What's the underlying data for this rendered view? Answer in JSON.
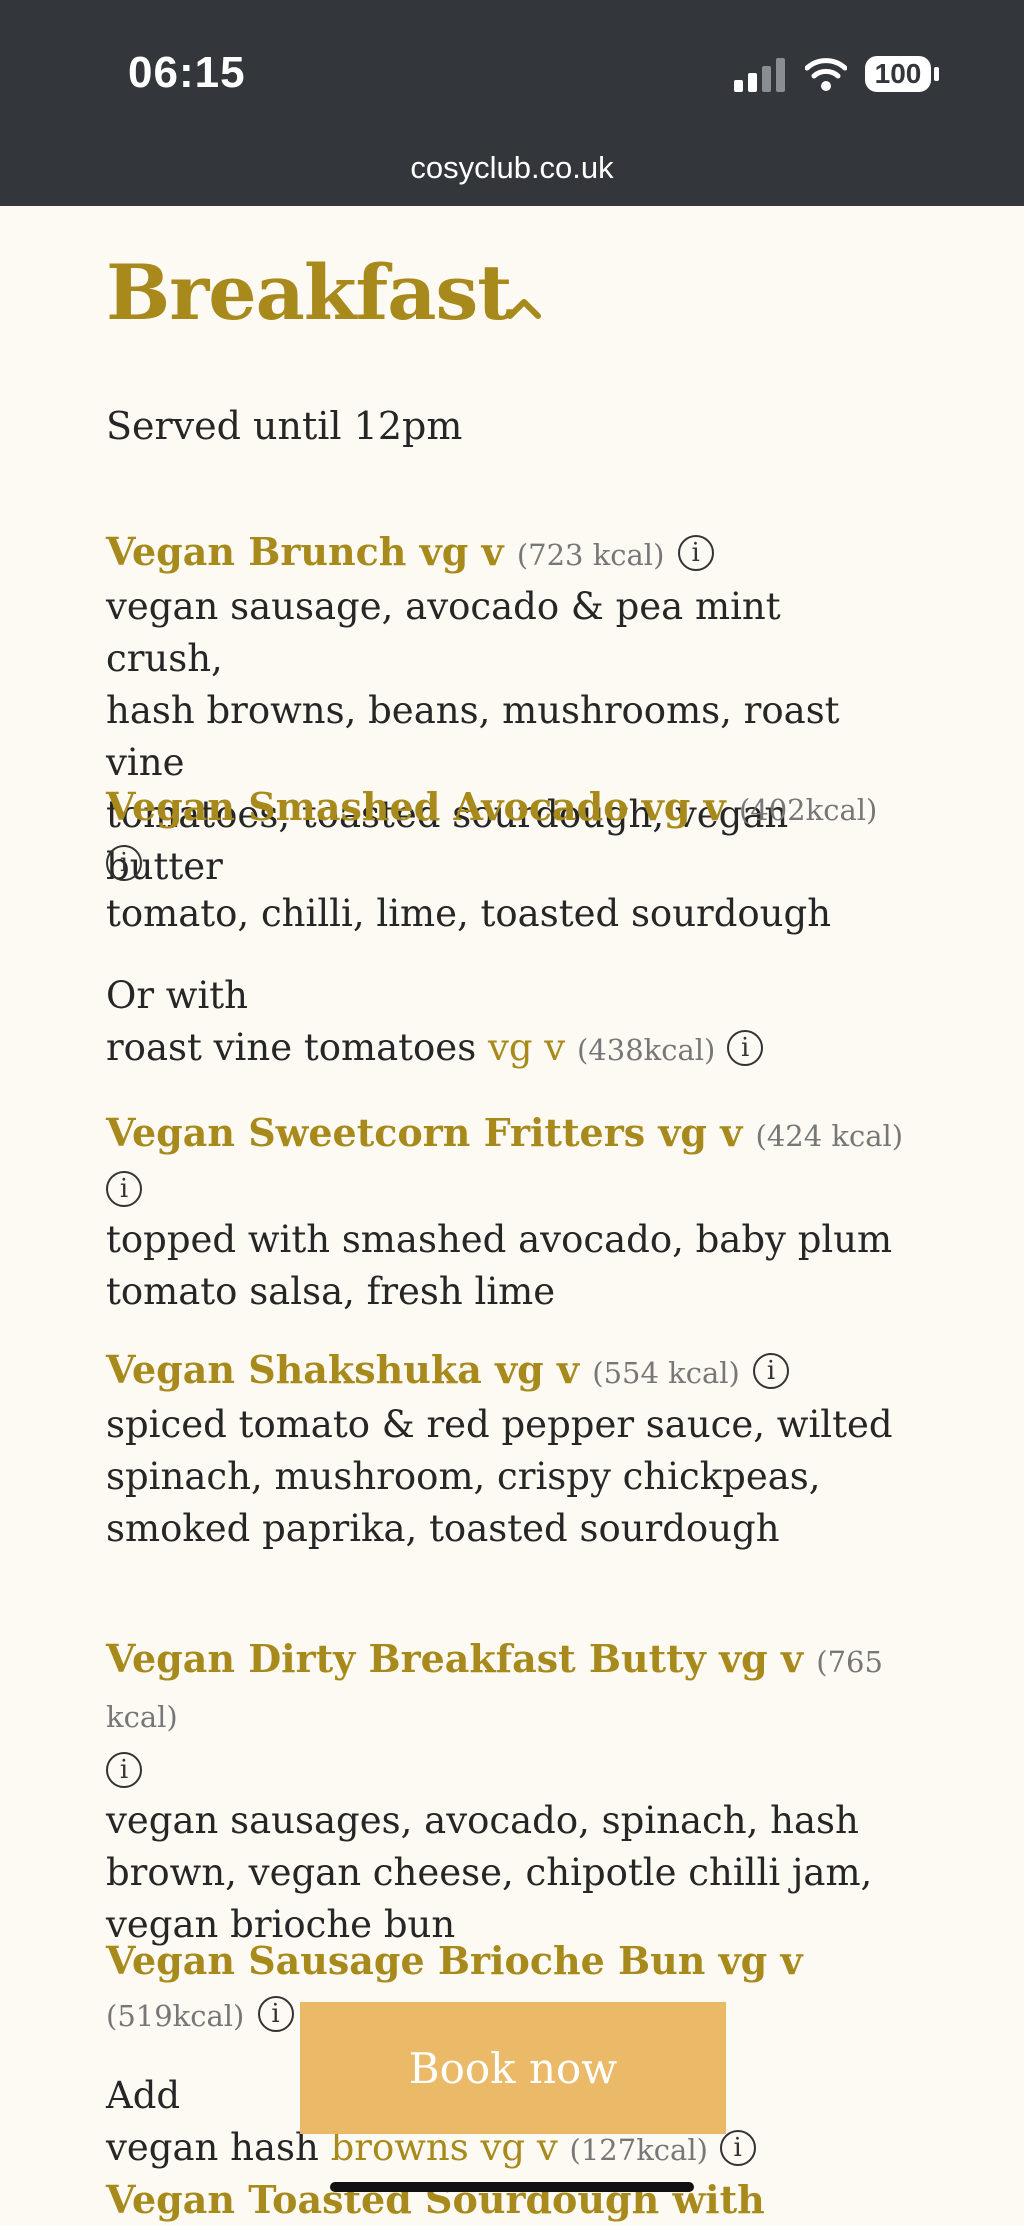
{
  "status": {
    "time": "06:15",
    "battery": "100",
    "url": "cosyclub.co.uk"
  },
  "section": {
    "title": "Breakfast",
    "served": "Served until 12pm"
  },
  "items": [
    {
      "name": "Vegan Brunch vg v",
      "kcal": "(723 kcal)",
      "desc": [
        "vegan sausage, avocado & pea mint crush,",
        "hash browns, beans, mushrooms, roast vine",
        "tomatoes, toasted sourdough, vegan butter"
      ]
    },
    {
      "name": "Vegan Smashed Avocado vg v",
      "kcal": "(402kcal)",
      "desc": [
        "tomato, chilli, lime, toasted sourdough"
      ]
    },
    {
      "name": "Vegan Sweetcorn Fritters vg v",
      "kcal": "(424 kcal)",
      "desc": [
        "topped with smashed avocado, baby plum",
        "tomato salsa, fresh lime"
      ]
    },
    {
      "name": "Vegan Shakshuka vg v",
      "kcal": "(554 kcal)",
      "desc": [
        "spiced tomato & red pepper sauce, wilted",
        "spinach, mushroom, crispy chickpeas,",
        "smoked paprika, toasted sourdough"
      ]
    },
    {
      "name": "Vegan Dirty Breakfast Butty vg v",
      "kcal": "(765 kcal)",
      "desc": [
        "vegan sausages, avocado, spinach, hash",
        "brown, vegan cheese, chipotle chilli jam,",
        "vegan brioche bun"
      ]
    },
    {
      "name": "Vegan Sausage Brioche Bun vg v",
      "kcal": "(519kcal)"
    },
    {
      "name": "Vegan Toasted Sourdough with"
    }
  ],
  "variant_avocado": {
    "or": "Or with",
    "text": "roast vine tomatoes",
    "tag": "vg v",
    "kcal": "(438kcal)"
  },
  "variant_bun": {
    "add": "Add",
    "text": "vegan hash",
    "extra": "browns",
    "tag": "vg v",
    "kcal": "(127kcal)"
  },
  "info_glyph": "i",
  "book_now": "Book now",
  "colors": {
    "gold": "#a88a1c",
    "status_bar": "#33363a",
    "background": "#fcfaf3",
    "button": "#e8af50"
  }
}
